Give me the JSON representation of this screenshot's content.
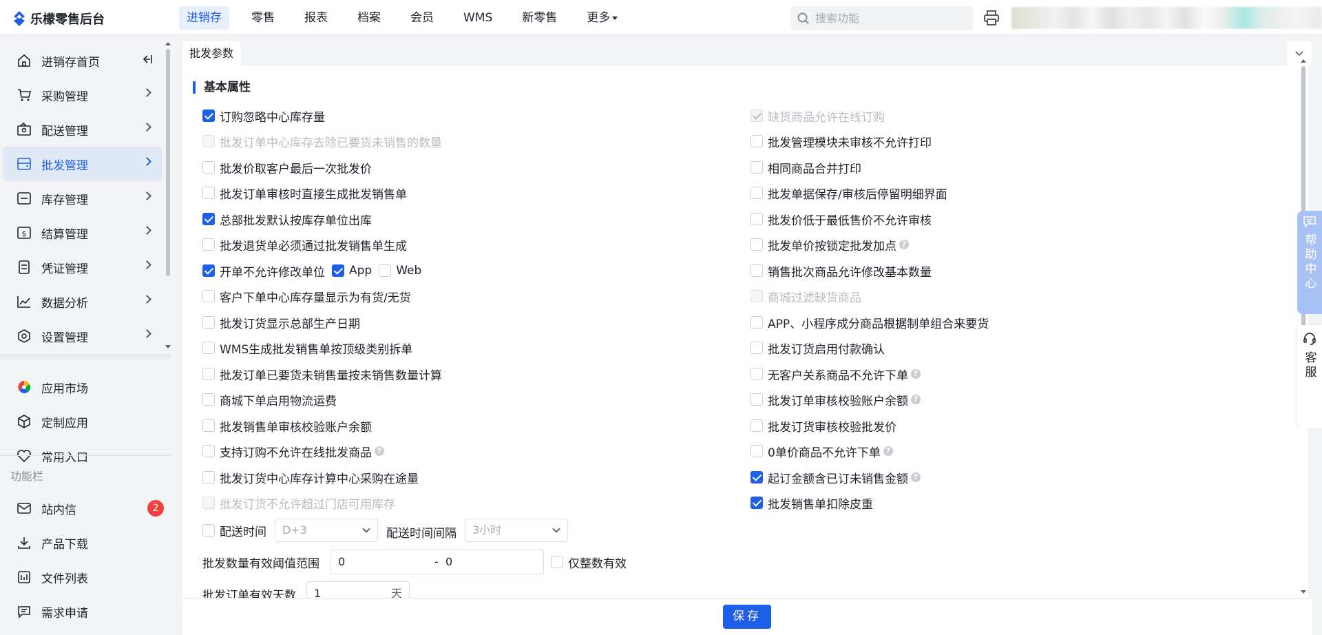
{
  "app": {
    "name": "乐檬零售后台"
  },
  "topnav": [
    {
      "label": "进销存",
      "active": true
    },
    {
      "label": "零售"
    },
    {
      "label": "报表"
    },
    {
      "label": "档案"
    },
    {
      "label": "会员"
    },
    {
      "label": "WMS"
    },
    {
      "label": "新零售"
    },
    {
      "label": "更多"
    }
  ],
  "search": {
    "placeholder": "搜索功能"
  },
  "sidebar": {
    "items": [
      {
        "label": "进销存首页",
        "icon": "home-icon"
      },
      {
        "label": "采购管理",
        "icon": "cart-icon"
      },
      {
        "label": "配送管理",
        "icon": "delivery-icon"
      },
      {
        "label": "批发管理",
        "icon": "wholesale-icon",
        "active": true
      },
      {
        "label": "库存管理",
        "icon": "inventory-icon"
      },
      {
        "label": "结算管理",
        "icon": "settlement-icon"
      },
      {
        "label": "凭证管理",
        "icon": "voucher-icon"
      },
      {
        "label": "数据分析",
        "icon": "chart-icon"
      },
      {
        "label": "设置管理",
        "icon": "settings-icon"
      }
    ],
    "bottom_items": [
      {
        "label": "应用市场",
        "icon": "app-market-icon"
      },
      {
        "label": "定制应用",
        "icon": "cube-icon"
      },
      {
        "label": "常用入口",
        "icon": "heart-icon"
      }
    ],
    "section_label": "功能栏",
    "func_items": [
      {
        "label": "站内信",
        "icon": "mail-icon",
        "badge": "2"
      },
      {
        "label": "产品下载",
        "icon": "download-icon"
      },
      {
        "label": "文件列表",
        "icon": "file-list-icon"
      },
      {
        "label": "需求申请",
        "icon": "request-icon"
      }
    ]
  },
  "tab": {
    "label": "批发参数"
  },
  "section": {
    "title": "基本属性"
  },
  "left_options": [
    {
      "label": "订购忽略中心库存量",
      "checked": true
    },
    {
      "label": "批发订单中心库存去除已要货未销售的数量",
      "disabled": true
    },
    {
      "label": "批发价取客户最后一次批发价"
    },
    {
      "label": "批发订单审核时直接生成批发销售单"
    },
    {
      "label": "总部批发默认按库存单位出库",
      "checked": true
    },
    {
      "label": "批发退货单必须通过批发销售单生成"
    },
    {
      "label": "开单不允许修改单位",
      "checked": true
    },
    {
      "label": "客户下单中心库存量显示为有货/无货"
    },
    {
      "label": "批发订货显示总部生产日期"
    },
    {
      "label": "WMS生成批发销售单按顶级类别拆单"
    },
    {
      "label": "批发订单已要货未销售量按未销售数量计算"
    },
    {
      "label": "商城下单启用物流运费"
    },
    {
      "label": "批发销售单审核校验账户余额"
    },
    {
      "label": "支持订购不允许在线批发商品",
      "help": true
    },
    {
      "label": "批发订货中心库存计算中心采购在途量"
    },
    {
      "label": "批发订货不允许超过门店可用库存",
      "disabled": true
    }
  ],
  "unit_sub": {
    "app": "App",
    "web": "Web"
  },
  "right_options": [
    {
      "label": "缺货商品允许在线订购",
      "checked": true,
      "disabled": true
    },
    {
      "label": "批发管理模块未审核不允许打印"
    },
    {
      "label": "相同商品合并打印"
    },
    {
      "label": "批发单据保存/审核后停留明细界面"
    },
    {
      "label": "批发价低于最低售价不允许审核"
    },
    {
      "label": "批发单价按锁定批发加点",
      "help": true
    },
    {
      "label": "销售批次商品允许修改基本数量"
    },
    {
      "label": "商城过滤缺货商品",
      "disabled": true
    },
    {
      "label": "APP、小程序成分商品根据制单组合来要货"
    },
    {
      "label": "批发订货启用付款确认"
    },
    {
      "label": "无客户关系商品不允许下单",
      "help": true
    },
    {
      "label": "批发订单审核校验账户余额",
      "help": true
    },
    {
      "label": "批发订货审核校验批发价"
    },
    {
      "label": "0单价商品不允许下单",
      "help": true
    },
    {
      "label": "起订金额含已订未销售金额",
      "checked": true,
      "help": true
    },
    {
      "label": "批发销售单扣除皮重",
      "checked": true
    }
  ],
  "delivery": {
    "time_label": "配送时间",
    "time_value": "D+3",
    "interval_label": "配送时间间隔",
    "interval_value": "3小时"
  },
  "threshold": {
    "label": "批发数量有效阈值范围",
    "min": "0",
    "sep": "-",
    "max": "0",
    "integer_label": "仅整数有效"
  },
  "valid_days": {
    "label": "批发订单有效天数",
    "value": "1",
    "unit": "天"
  },
  "footer": {
    "save_label": "保存"
  },
  "float": {
    "help_center": "帮助中心",
    "kefu": "客服"
  },
  "colors": {
    "accent": "#1d5fe8",
    "badge": "#f53f3f",
    "help_center_bg": "#a8c1f5"
  }
}
